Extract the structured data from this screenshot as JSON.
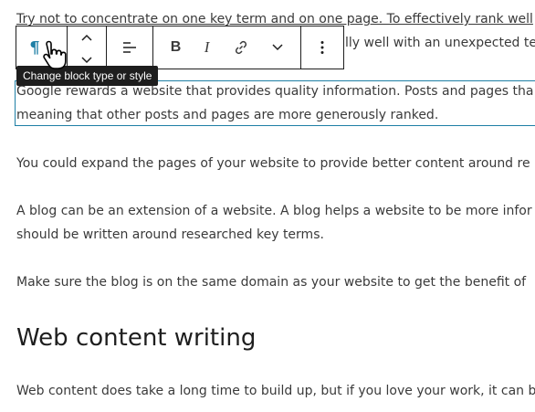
{
  "paragraphs": {
    "p1_line1": "Try not to concentrate on one key term and on one page. To effectively rank well",
    "p1_line2": "lly well with an unexpected te",
    "p2_line1": "Google rewards a website that provides quality information. Posts and pages tha",
    "p2_line2": "meaning that other posts and pages are more generously ranked.",
    "p3": "You could expand the pages of your website to provide better content around re",
    "p4_line1": "A blog can be an extension of a website. A blog helps a website to be more infor",
    "p4_line2": "should be written around researched key terms.",
    "p5": "Make sure the blog is on the same domain as your website to get the benefit of",
    "p6": "Web content does take a long time to build up, but if you love your work, it can b"
  },
  "heading": "Web content writing",
  "toolbar": {
    "block_type_icon": "pilcrow-icon",
    "move_up_icon": "chevron-up-icon",
    "move_down_icon": "chevron-down-icon",
    "align_icon": "align-left-icon",
    "bold_label": "B",
    "italic_label": "I",
    "link_icon": "link-icon",
    "more_formatting_icon": "chevron-down-icon",
    "options_icon": "more-vertical-icon",
    "pilcrow_glyph": "¶"
  },
  "tooltip": "Change block type or style",
  "colors": {
    "accent": "#1e7fa5",
    "text": "#3a3a3a",
    "toolbar_border": "#1e1e1e",
    "tooltip_bg": "#1e1e1e"
  }
}
